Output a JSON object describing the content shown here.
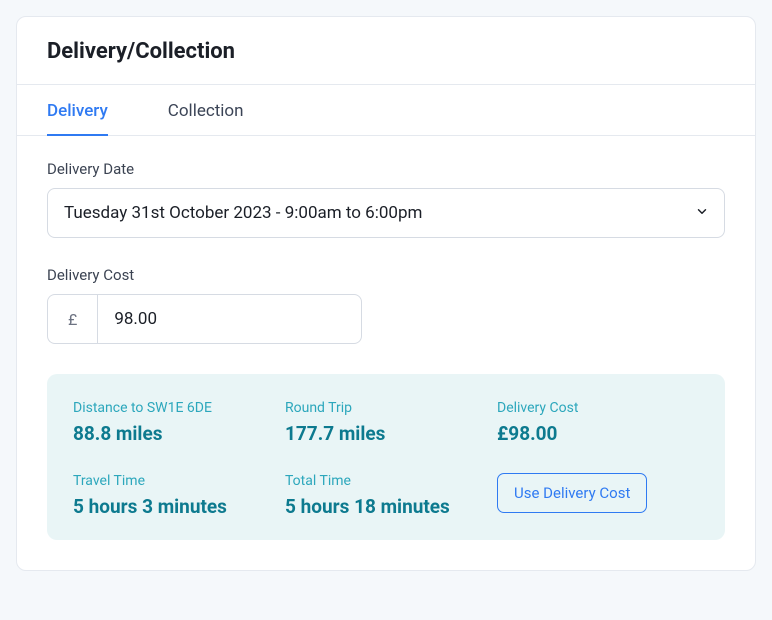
{
  "header": {
    "title": "Delivery/Collection"
  },
  "tabs": {
    "delivery": "Delivery",
    "collection": "Collection"
  },
  "deliveryDate": {
    "label": "Delivery Date",
    "value": "Tuesday 31st October 2023 - 9:00am to 6:00pm"
  },
  "deliveryCost": {
    "label": "Delivery Cost",
    "currency": "£",
    "value": "98.00"
  },
  "summary": {
    "distance": {
      "label": "Distance to SW1E 6DE",
      "value": "88.8 miles"
    },
    "roundTrip": {
      "label": "Round Trip",
      "value": "177.7 miles"
    },
    "delCost": {
      "label": "Delivery Cost",
      "value": "£98.00"
    },
    "travelTime": {
      "label": "Travel Time",
      "value": "5 hours 3 minutes"
    },
    "totalTime": {
      "label": "Total Time",
      "value": "5 hours 18 minutes"
    },
    "useButton": "Use Delivery Cost"
  }
}
